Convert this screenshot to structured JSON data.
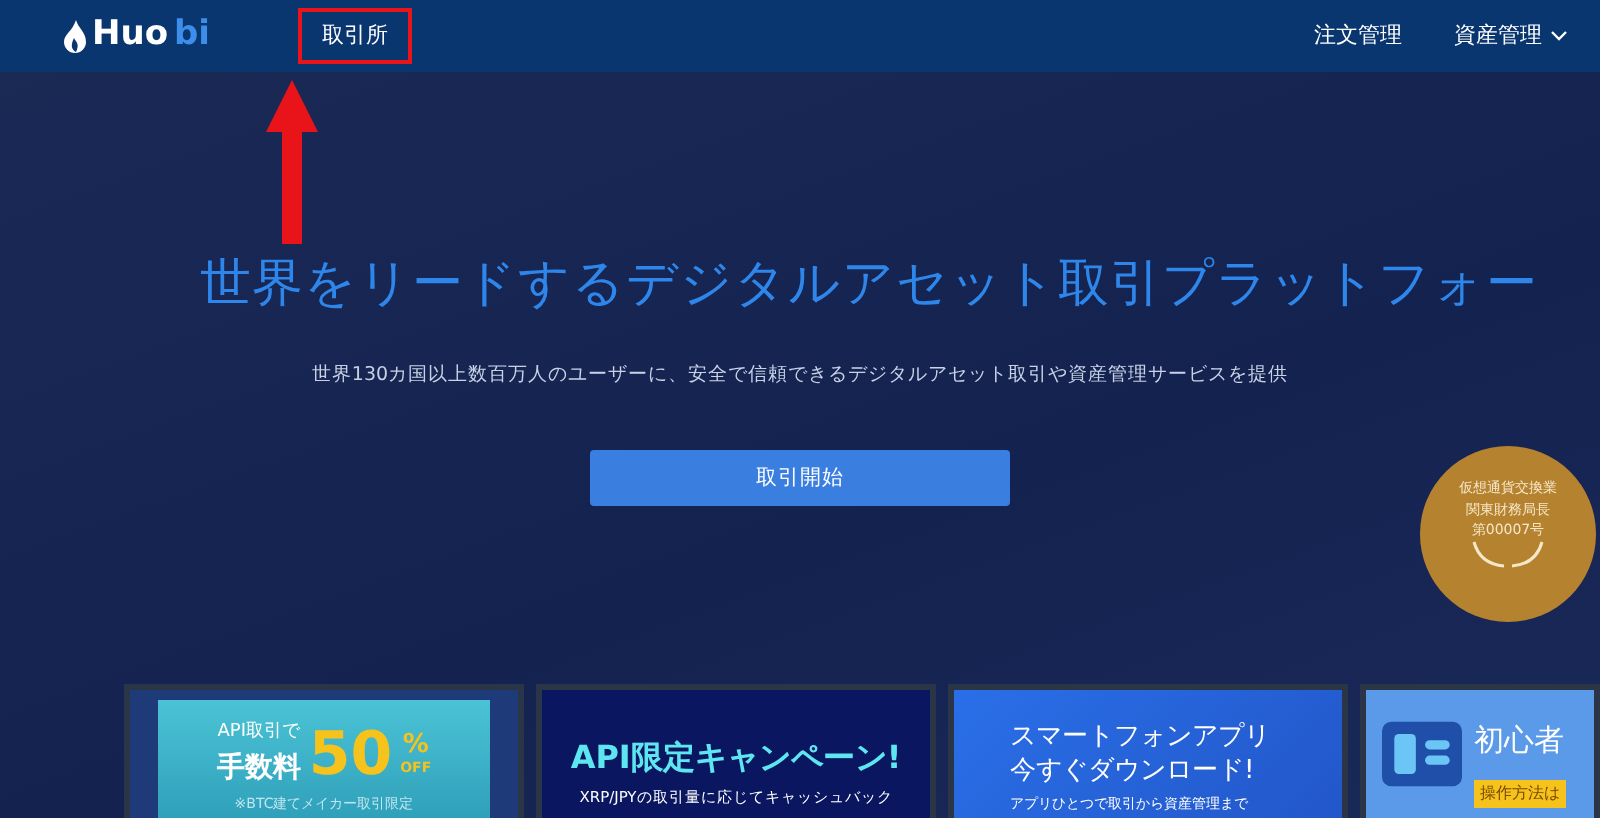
{
  "navbar": {
    "logo": {
      "part_1": "Huo",
      "part_2": "bi"
    },
    "links": [
      {
        "label": "取引所",
        "highlighted": true
      }
    ],
    "right_links": [
      {
        "label": "注文管理",
        "dropdown": false
      },
      {
        "label": "資産管理",
        "dropdown": true
      }
    ]
  },
  "hero": {
    "title": "世界をリードするデジタルアセット取引プラットフォー",
    "subtitle": "世界130カ国以上数百万人のユーザーに、安全で信頼できるデジタルアセット取引や資産管理サービスを提供",
    "button": "取引開始"
  },
  "license_badge": {
    "lines": [
      "仮想通貨交換業",
      "関東財務局長",
      "第00007号"
    ]
  },
  "banners": [
    {
      "kind": "fee",
      "line_1": "API取引で",
      "line_2": "手数料",
      "big": "50",
      "percent": "%",
      "off": "OFF",
      "note": "※BTC建てメイカー取引限定"
    },
    {
      "kind": "campaign",
      "title": "API限定キャンペーン!",
      "subtitle": "XRP/JPYの取引量に応じてキャッシュバック"
    },
    {
      "kind": "app",
      "line_1": "スマートフォンアプリ",
      "line_2": "今すぐダウンロード!",
      "subtitle": "アプリひとつで取引から資産管理まで"
    },
    {
      "kind": "guide",
      "title": "初心者",
      "tag": "操作方法は"
    }
  ]
}
